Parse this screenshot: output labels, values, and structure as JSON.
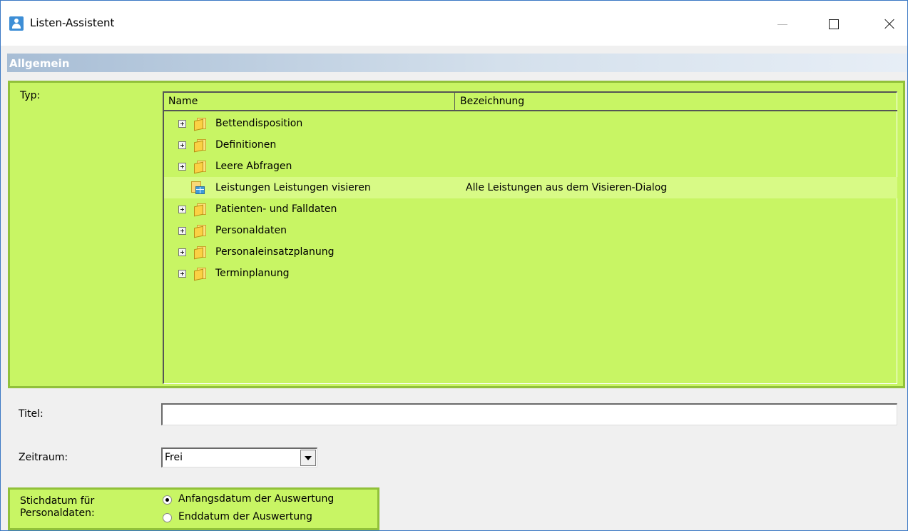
{
  "window": {
    "title": "Listen-Assistent"
  },
  "section": {
    "title": "Allgemein"
  },
  "typ": {
    "label": "Typ:",
    "columns": [
      "Name",
      "Bezeichnung"
    ],
    "rows": [
      {
        "name": "Bettendisposition",
        "bezeichnung": "",
        "kind": "folder",
        "expandable": true
      },
      {
        "name": "Definitionen",
        "bezeichnung": "",
        "kind": "folder",
        "expandable": true
      },
      {
        "name": "Leere Abfragen",
        "bezeichnung": "",
        "kind": "folder",
        "expandable": true
      },
      {
        "name": "Leistungen Leistungen visieren",
        "bezeichnung": "Alle Leistungen aus dem Visieren-Dialog",
        "kind": "query",
        "expandable": false
      },
      {
        "name": "Patienten- und Falldaten",
        "bezeichnung": "",
        "kind": "folder",
        "expandable": true
      },
      {
        "name": "Personaldaten",
        "bezeichnung": "",
        "kind": "folder",
        "expandable": true
      },
      {
        "name": "Personaleinsatzplanung",
        "bezeichnung": "",
        "kind": "folder",
        "expandable": true
      },
      {
        "name": "Terminplanung",
        "bezeichnung": "",
        "kind": "folder",
        "expandable": true
      }
    ]
  },
  "titel": {
    "label": "Titel:",
    "value": ""
  },
  "zeitraum": {
    "label": "Zeitraum:",
    "value": "Frei"
  },
  "stichdatum": {
    "label_line1": "Stichdatum für",
    "label_line2": "Personaldaten:",
    "options": [
      {
        "label": "Anfangsdatum der Auswertung",
        "selected": true
      },
      {
        "label": "Enddatum der Auswertung",
        "selected": false
      }
    ]
  },
  "colors": {
    "highlight_panel": "#c8f564",
    "highlight_border": "#91c13a",
    "window_border": "#3a78c4"
  }
}
